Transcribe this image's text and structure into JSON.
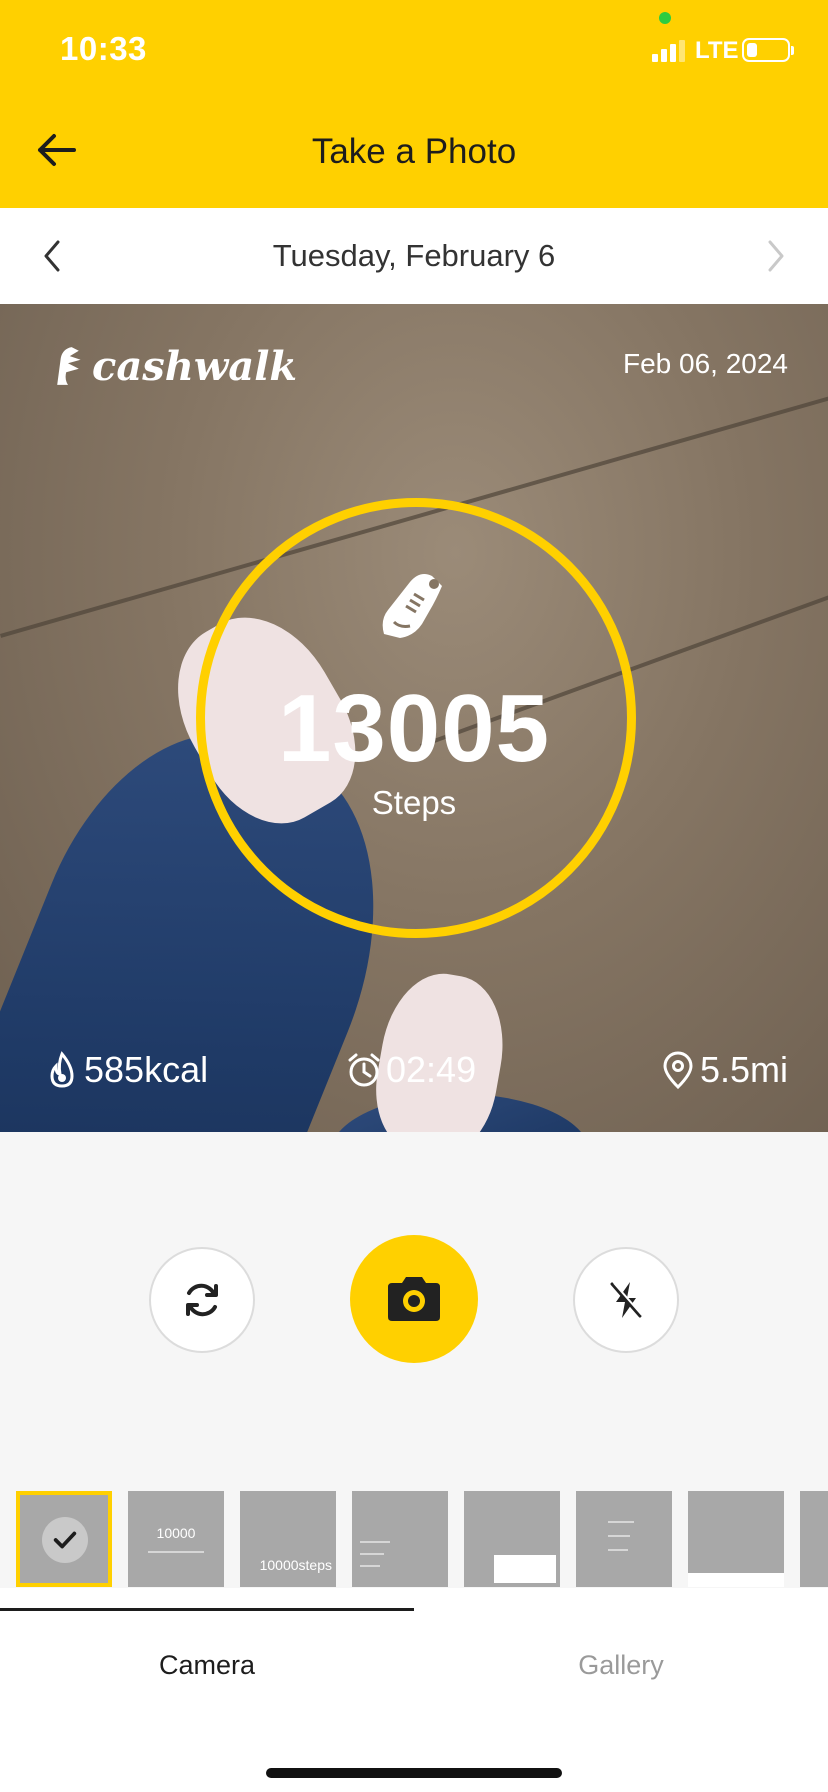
{
  "status_bar": {
    "time": "10:33",
    "network": "LTE",
    "battery_level": 0.25
  },
  "header": {
    "title": "Take a Photo",
    "back_icon": "arrow-left-icon"
  },
  "date_nav": {
    "date": "Tuesday, February 6",
    "prev_icon": "chevron-left-icon",
    "next_icon": "chevron-right-icon"
  },
  "photo": {
    "brand": "cashwalk",
    "date": "Feb 06, 2024",
    "steps": "13005",
    "steps_label": "Steps",
    "calories": "585kcal",
    "duration": "02:49",
    "distance": "5.5mi"
  },
  "controls": {
    "switch_icon": "refresh-icon",
    "shutter_icon": "camera-icon",
    "flash_icon": "flash-off-icon"
  },
  "thumbnails": [
    {
      "id": "t1",
      "selected": true
    },
    {
      "id": "t2",
      "text": "10000"
    },
    {
      "id": "t3",
      "text": "10000steps"
    },
    {
      "id": "t4"
    },
    {
      "id": "t5"
    },
    {
      "id": "t6"
    },
    {
      "id": "t7"
    },
    {
      "id": "t8"
    }
  ],
  "tabs": {
    "camera": "Camera",
    "gallery": "Gallery"
  },
  "colors": {
    "accent": "#FFD000",
    "background": "#f6f6f6"
  }
}
